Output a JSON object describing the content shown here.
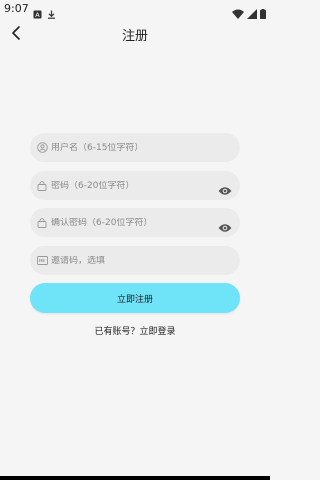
{
  "status_bar": {
    "time": "9:07",
    "left_icons": [
      "notification-a-icon",
      "download-icon"
    ],
    "right_icons": [
      "wifi-icon",
      "signal-icon",
      "battery-icon"
    ]
  },
  "header": {
    "title": "注册"
  },
  "form": {
    "username_placeholder": "用户名（6-15位字符）",
    "password_placeholder": "密码（6-20位字符）",
    "confirm_password_placeholder": "确认密码（6-20位字符）",
    "invite_code_placeholder": "邀请码，选填"
  },
  "actions": {
    "submit_label": "立即注册",
    "login_link": "已有账号？立即登录"
  },
  "colors": {
    "background": "#f5f5f5",
    "field_background": "#ebebeb",
    "accent": "#6fe3f7"
  }
}
